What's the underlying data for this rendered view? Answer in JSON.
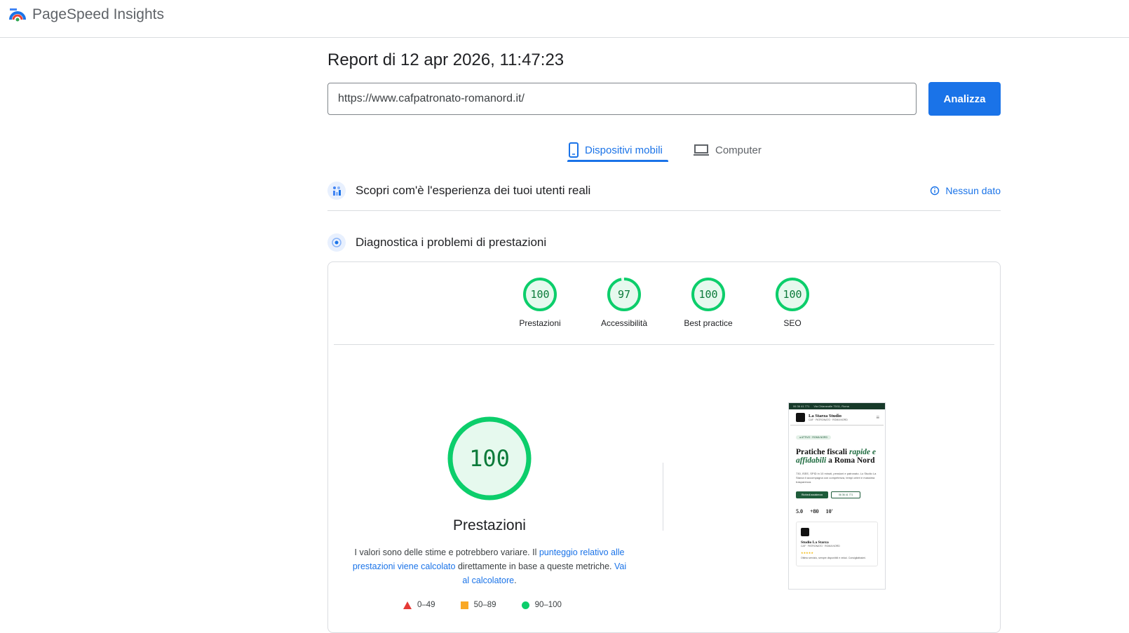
{
  "app": {
    "title": "PageSpeed Insights",
    "logo_icon": "pagespeed-logo-icon"
  },
  "report": {
    "title": "Report di 12 apr 2026, 11:47:23"
  },
  "search": {
    "url": "https://www.cafpatronato-romanord.it/",
    "button_label": "Analizza"
  },
  "tabs": [
    {
      "label": "Dispositivi mobili",
      "icon": "smartphone-icon",
      "active": true
    },
    {
      "label": "Computer",
      "icon": "laptop-icon",
      "active": false
    }
  ],
  "field_data": {
    "title": "Scopri com'è l'esperienza dei tuoi utenti reali",
    "no_data_label": "Nessun dato",
    "icon": "users-chart-icon"
  },
  "diagnostics": {
    "title": "Diagnostica i problemi di prestazioni",
    "icon": "lighthouse-icon"
  },
  "scores": [
    {
      "label": "Prestazioni",
      "value": "100",
      "fraction": 1.0
    },
    {
      "label": "Accessibilità",
      "value": "97",
      "fraction": 0.97
    },
    {
      "label": "Best practice",
      "value": "100",
      "fraction": 1.0
    },
    {
      "label": "SEO",
      "value": "100",
      "fraction": 1.0
    }
  ],
  "performance": {
    "value": "100",
    "label": "Prestazioni",
    "desc_1": "I valori sono delle stime e potrebbero variare. Il ",
    "link_1": "punteggio relativo alle prestazioni viene calcolato",
    "desc_2": " direttamente in base a queste metriche. ",
    "link_2": "Vai al calcolatore",
    "desc_3": "."
  },
  "legend": [
    {
      "label": "0–49",
      "shape": "triangle",
      "color": "#e53935"
    },
    {
      "label": "50–89",
      "shape": "square",
      "color": "#f9a825"
    },
    {
      "label": "90–100",
      "shape": "circle",
      "color": "#0cce6b"
    }
  ],
  "colors": {
    "accent": "#1a73e8",
    "pass_stroke": "#0cce6b",
    "pass_fill": "#e6f9ee",
    "pass_text": "#0c7a3a"
  },
  "site_preview": {
    "topbar_phone": "06 36 41 771",
    "topbar_address": "Via Chiaravalle 75/11, Roma",
    "brand": "La Starza Studio",
    "brand_sub": "CAF · PATRONATO · ROMA NORD",
    "pill": "● ATTIVO · ROMA NORD",
    "h1_a": "Pratiche fiscali ",
    "h1_em": "rapide e affidabili",
    "h1_b": " a Roma Nord",
    "paragraph": "730, ISEE, SPID in 10 minuti, pensioni e patronato. Lo Studio La Starza ti accompagna con competenza, tempi celeri e massima trasparenza.",
    "btn_primary": "Richiedi assistenza",
    "btn_secondary": "06 36 41 771",
    "stats": [
      "5.0",
      "+80",
      "10'"
    ],
    "card_title": "Studio La Starza",
    "card_sub": "CAF · PATRONATO · ROMA NORD",
    "card_stars": "★★★★★",
    "card_quote": "Ottimo servizio, sempre disponibili e veloci. Consigliatissimi."
  }
}
